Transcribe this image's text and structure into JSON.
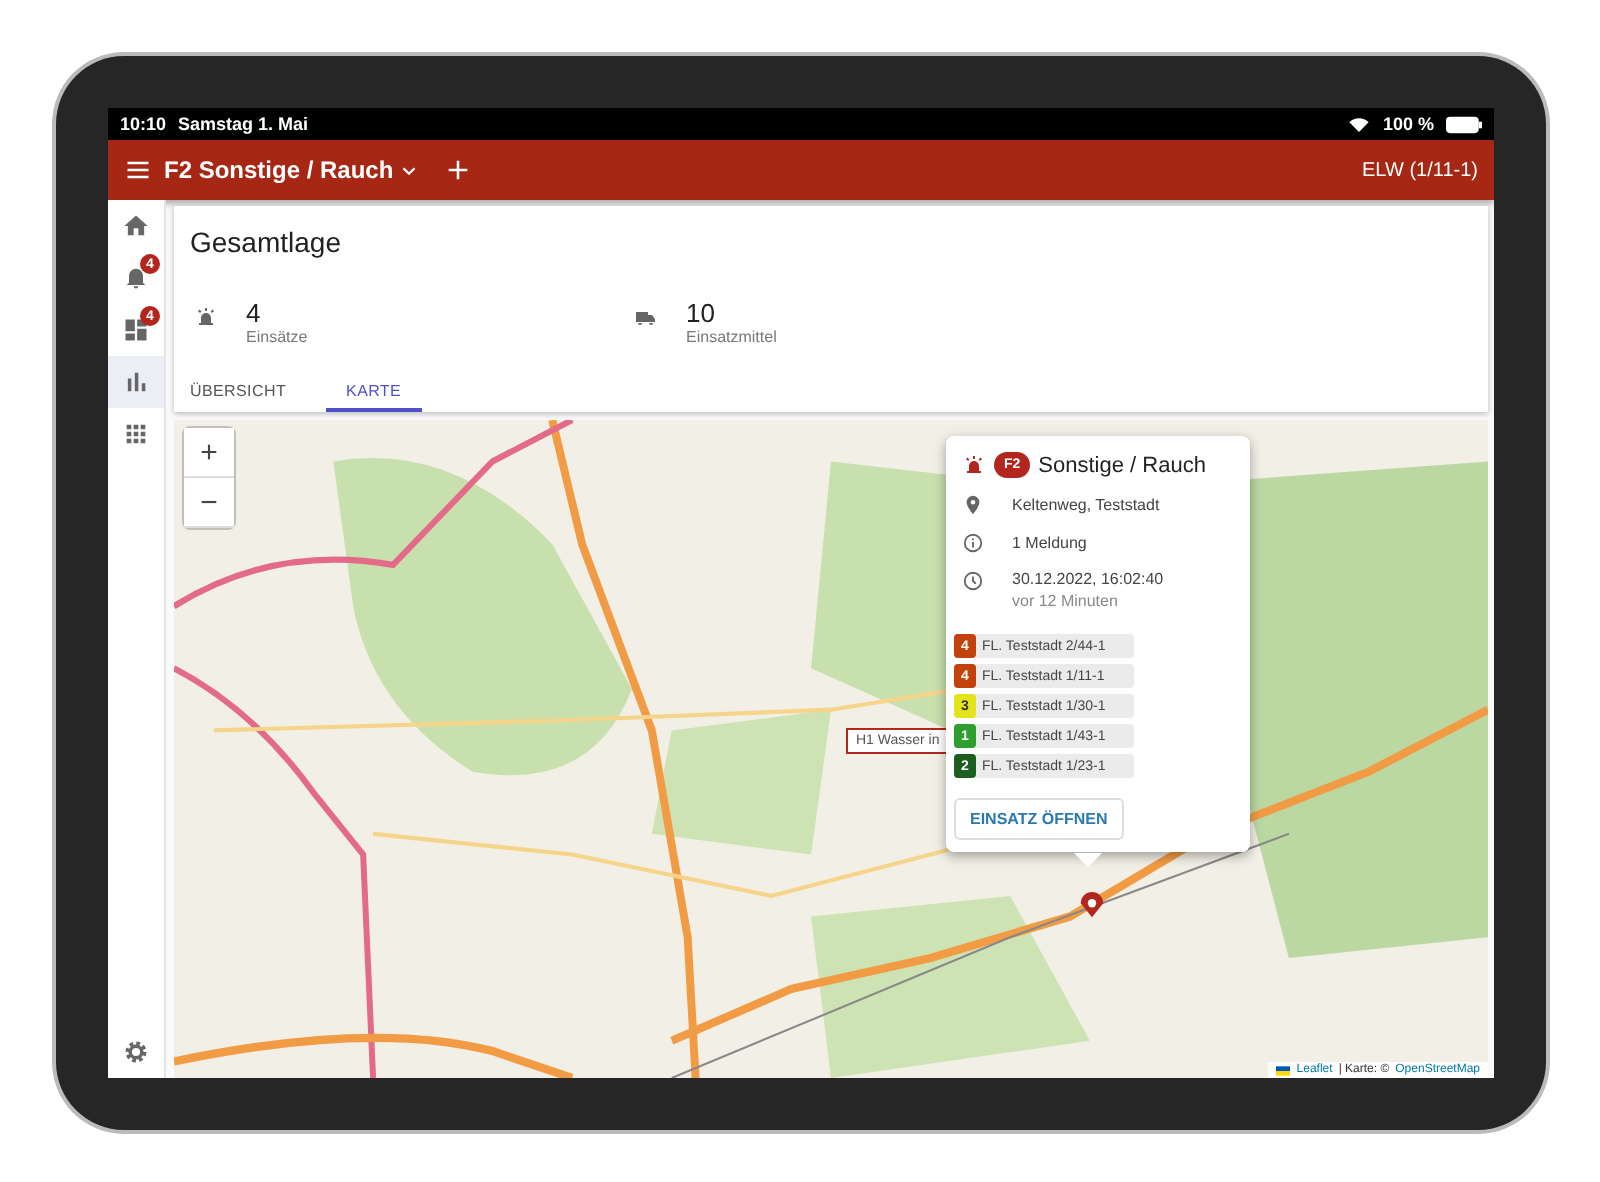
{
  "status_bar": {
    "time": "10:10",
    "date": "Samstag 1. Mai",
    "battery": "100 %"
  },
  "app_bar": {
    "title": "F2 Sonstige / Rauch",
    "vehicle": "ELW (1/11-1)"
  },
  "nav": [
    {
      "kind": "home",
      "selected": false
    },
    {
      "kind": "bell",
      "badge": "4",
      "selected": false
    },
    {
      "kind": "dashboard",
      "badge": "4",
      "selected": false
    },
    {
      "kind": "chart",
      "selected": true
    },
    {
      "kind": "apps",
      "selected": false
    }
  ],
  "header": {
    "title": "Gesamtlage",
    "stats": [
      {
        "kind": "alarm",
        "value": "4",
        "label": "Einsätze"
      },
      {
        "kind": "truck",
        "value": "10",
        "label": "Einsatzmittel"
      }
    ]
  },
  "tabs": [
    {
      "label": "ÜBERSICHT",
      "selected": false
    },
    {
      "label": "KARTE",
      "selected": true
    }
  ],
  "map": {
    "zoom_in": "+",
    "zoom_out": "−",
    "marker_label": "H1 Wasser in",
    "attribution_link": "Leaflet",
    "attribution_text": "| Karte: ©",
    "attribution_osm": "OpenStreetMap"
  },
  "popup": {
    "badge": "F2",
    "title": "Sonstige / Rauch",
    "address": "Keltenweg, Teststadt",
    "reports": "1 Meldung",
    "time": "30.12.2022, 16:02:40",
    "ago": "vor 12 Minuten",
    "units": [
      {
        "status": "4",
        "name": "FL. Teststadt 2/44-1",
        "color": "#c2410c"
      },
      {
        "status": "4",
        "name": "FL. Teststadt 1/11-1",
        "color": "#c2410c"
      },
      {
        "status": "3",
        "name": "FL. Teststadt 1/30-1",
        "color": "#e4e41c"
      },
      {
        "status": "1",
        "name": "FL. Teststadt 1/43-1",
        "color": "#2e9e2e"
      },
      {
        "status": "2",
        "name": "FL. Teststadt 1/23-1",
        "color": "#1b5e20"
      }
    ],
    "button": "EINSATZ ÖFFNEN"
  }
}
